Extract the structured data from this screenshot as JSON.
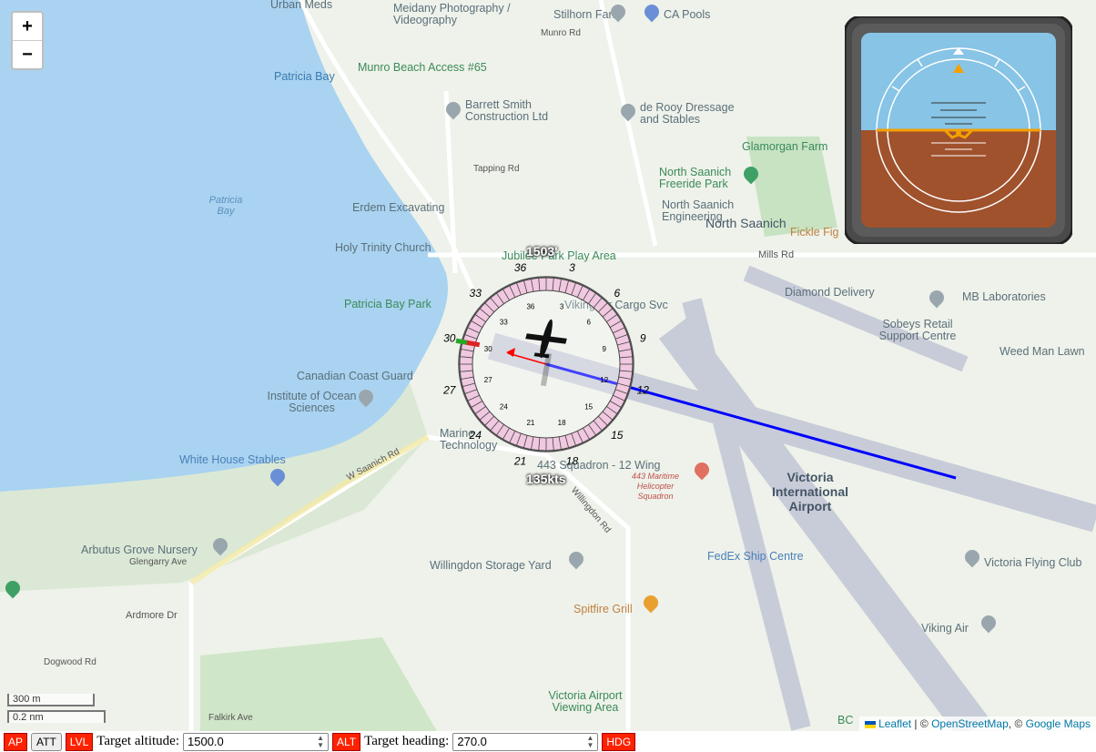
{
  "map": {
    "zoom_in": "+",
    "zoom_out": "−",
    "scale_m": "300 m",
    "scale_nm": "0.2 nm",
    "attribution": {
      "leaflet": "Leaflet",
      "sep1": " | © ",
      "osm": "OpenStreetMap",
      "sep2": ", © ",
      "google": "Google Maps"
    },
    "places": [
      "Urban Meds",
      "Meidany Photography / Videography",
      "Stilhorn Farm",
      "CA Pools",
      "Munro Rd",
      "Patricia Bay",
      "Munro Beach Access #65",
      "Barrett Smith Construction Ltd",
      "de Rooy Dressage and Stables",
      "Glamorgan Farm",
      "North Saanich Freeride Park",
      "North Saanich Engineering",
      "North Saanich",
      "Tapping Rd",
      "Erdem Excavating",
      "Holy Trinity Church",
      "Jubilee Park Play Area",
      "Fickle Fig",
      "Mills Rd",
      "Diamond Delivery",
      "MB Laboratories",
      "Sobeys Retail Support Centre",
      "Weed Man Lawn",
      "Patricia Bay Park",
      "Viking Air Cargo Svc",
      "Canadian Coast Guard",
      "Institute of Ocean Sciences",
      "Marine Technology",
      "White House Stables",
      "443 Squadron - 12 Wing",
      "443 Maritime Helicopter Squadron",
      "Victoria International Airport",
      "FedEx Ship Centre",
      "Victoria Flying Club",
      "Arbutus Grove Nursery",
      "Willingdon Storage Yard",
      "Spitfire Grill",
      "Viking Air",
      "Ardmore Dr",
      "Victoria Airport Viewing Area",
      "Patricia Bay",
      "Glengarry Ave",
      "W Saanich Rd",
      "Willingdon Rd",
      "Falkirk Ave",
      "Dogwood Rd",
      "BC"
    ]
  },
  "hud": {
    "altitude": "1503'",
    "speed": "135kts",
    "heading_deg": 285,
    "compass_outer_labels": [
      "36",
      "3",
      "6",
      "9",
      "12",
      "15",
      "18",
      "21",
      "24",
      "27",
      "30",
      "33"
    ],
    "compass_inner_labels": [
      "3",
      "6",
      "9",
      "12",
      "15",
      "18",
      "21",
      "24",
      "27",
      "30",
      "33",
      "36"
    ]
  },
  "attitude": {
    "pitch_deg": 0,
    "roll_deg": 0,
    "sky_color": "#87c4e6",
    "ground_color": "#a0522d"
  },
  "controls": {
    "ap": "AP",
    "att": "ATT",
    "lvl": "LVL",
    "target_altitude_label": "Target altitude:",
    "target_altitude_value": "1500.0",
    "alt": "ALT",
    "target_heading_label": "Target heading:",
    "target_heading_value": "270.0",
    "hdg": "HDG"
  },
  "colors": {
    "route_line": "#0000ff",
    "heading_arrow": "#ff0000",
    "compass_ring": "#f0c8e0"
  }
}
